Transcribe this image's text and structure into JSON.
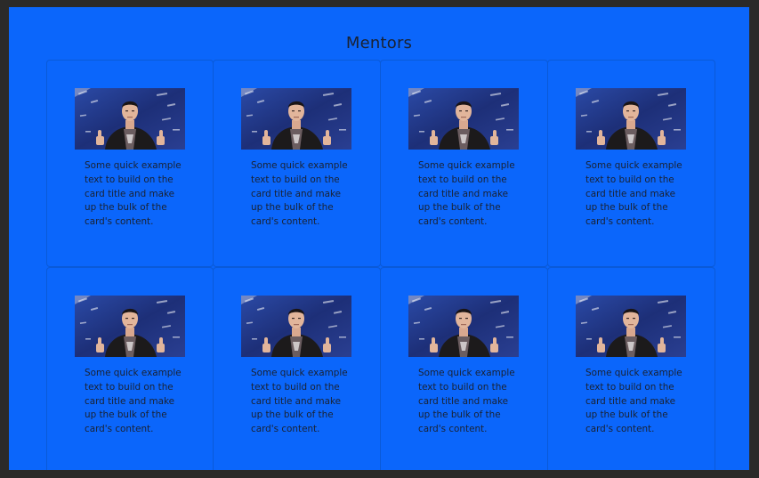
{
  "page": {
    "title": "Mentors"
  },
  "cards": [
    {
      "text": "Some quick example text to build on the card title and make up the bulk of the card's content."
    },
    {
      "text": "Some quick example text to build on the card title and make up the bulk of the card's content."
    },
    {
      "text": "Some quick example text to build on the card title and make up the bulk of the card's content."
    },
    {
      "text": "Some quick example text to build on the card title and make up the bulk of the card's content."
    },
    {
      "text": "Some quick example text to build on the card title and make up the bulk of the card's content."
    },
    {
      "text": "Some quick example text to build on the card title and make up the bulk of the card's content."
    },
    {
      "text": "Some quick example text to build on the card title and make up the bulk of the card's content."
    },
    {
      "text": "Some quick example text to build on the card title and make up the bulk of the card's content."
    }
  ],
  "colors": {
    "background": "#0b66fb",
    "outer": "#2b2a29",
    "text": "#1a2232"
  }
}
